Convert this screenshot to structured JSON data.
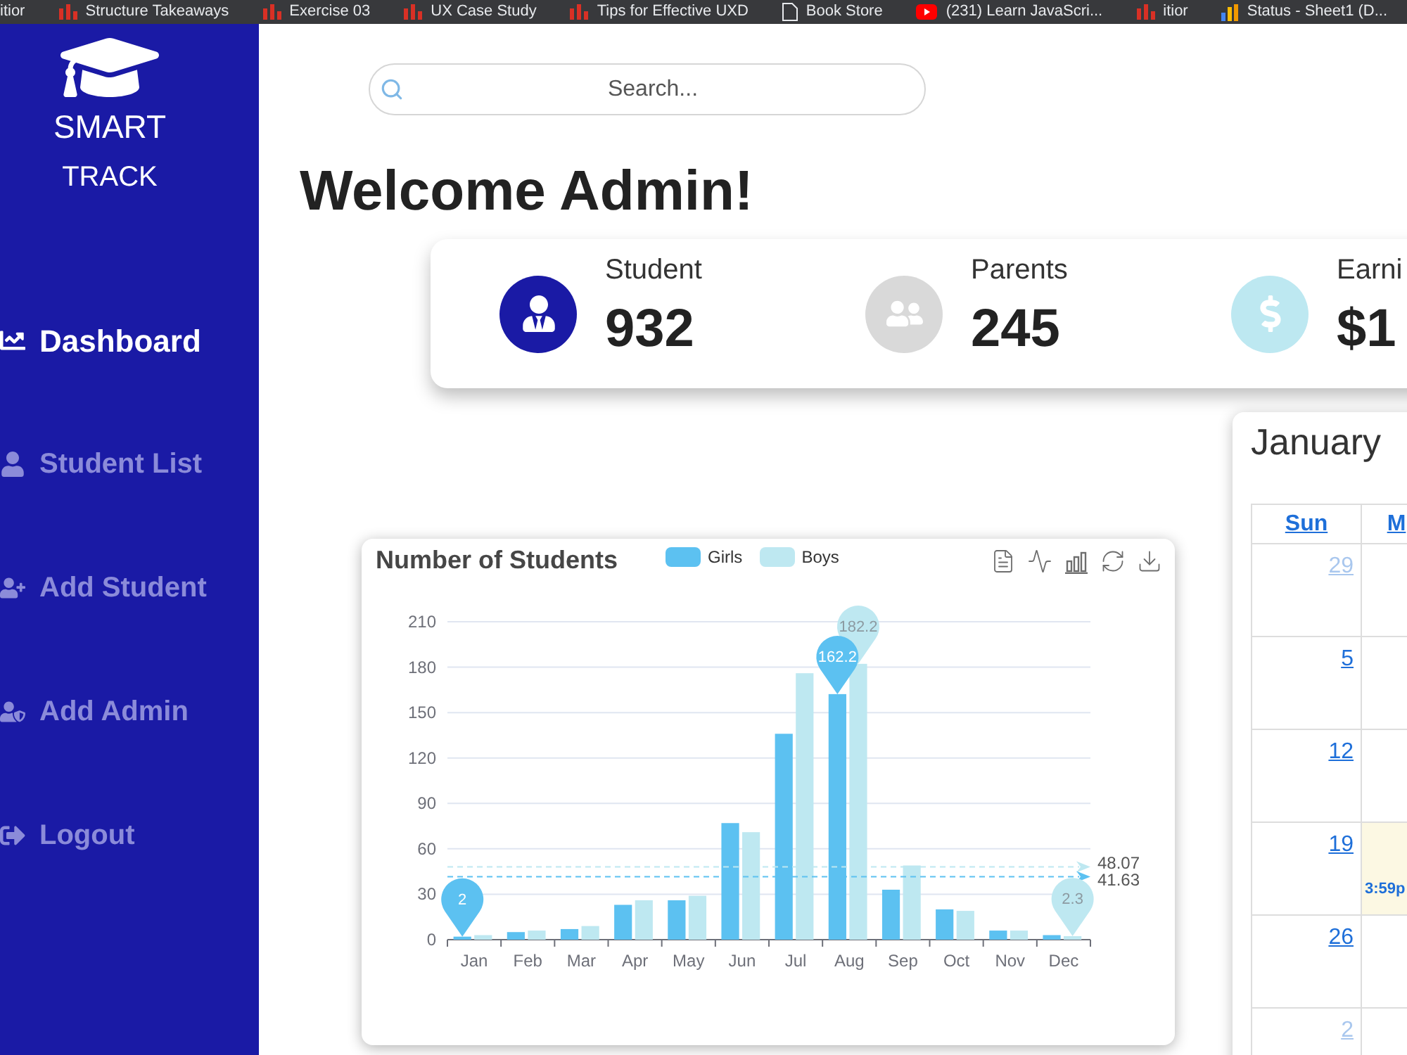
{
  "bookmarks": [
    {
      "label": "itior",
      "kind": "none"
    },
    {
      "label": "Structure Takeaways",
      "kind": "bars"
    },
    {
      "label": "Exercise 03",
      "kind": "bars"
    },
    {
      "label": "UX Case Study",
      "kind": "bars"
    },
    {
      "label": "Tips for Effective UXD",
      "kind": "bars"
    },
    {
      "label": "Book Store",
      "kind": "page"
    },
    {
      "label": "(231) Learn JavaScri...",
      "kind": "video"
    },
    {
      "label": "itior",
      "kind": "bars"
    },
    {
      "label": "Status - Sheet1 (D...",
      "kind": "chart"
    }
  ],
  "sidebar": {
    "logo": [
      "SMART",
      "TRACK"
    ],
    "items": [
      {
        "label": "Dashboard",
        "kind": "chart",
        "selected": true
      },
      {
        "label": "Student List",
        "kind": "user",
        "selected": false
      },
      {
        "label": "Add Student",
        "kind": "user-plus",
        "selected": false
      },
      {
        "label": "Add Admin",
        "kind": "user-shield",
        "selected": false
      },
      {
        "label": "Logout",
        "kind": "logout",
        "selected": false
      }
    ]
  },
  "search": {
    "placeholder": "Search..."
  },
  "heading": "Welcome Admin!",
  "stats": [
    {
      "label": "Student",
      "value": "932",
      "kind": "student",
      "color": "#1a1aa5"
    },
    {
      "label": "Parents",
      "value": "245",
      "kind": "parents",
      "color": "#d9d9d9"
    },
    {
      "label": "Earni",
      "value": "$1",
      "kind": "earnings",
      "color": "#bde8f1"
    }
  ],
  "students_chart": {
    "chart_data": {
      "type": "bar",
      "title": "Number of Students",
      "categories": [
        "Jan",
        "Feb",
        "Mar",
        "Apr",
        "May",
        "Jun",
        "Jul",
        "Aug",
        "Sep",
        "Oct",
        "Nov",
        "Dec"
      ],
      "series": [
        {
          "name": "Girls",
          "color": "#5cc1f1",
          "values": [
            2,
            5,
            7,
            23,
            26,
            77,
            136,
            162.2,
            33,
            20,
            6,
            3
          ]
        },
        {
          "name": "Boys",
          "color": "#bee8f1",
          "values": [
            3,
            6,
            9,
            26,
            29,
            71,
            176,
            182.2,
            49,
            19,
            6,
            2.3
          ]
        }
      ],
      "ylim": [
        0,
        210
      ],
      "yticks": [
        0,
        30,
        60,
        90,
        120,
        150,
        180,
        210
      ],
      "grid": true,
      "legend": "top",
      "ref_lines": [
        {
          "axis": "y",
          "value": 48.07,
          "label": "48.07",
          "color": "#bee8f1",
          "line_style": "dashed"
        },
        {
          "axis": "y",
          "value": 41.63,
          "label": "41.63",
          "color": "#5cc1f1",
          "line_style": "dashed"
        }
      ],
      "annotations": [
        "2",
        "162.2",
        "182.2",
        "2.3"
      ]
    }
  },
  "calendar": {
    "title": "January",
    "columns": [
      "Sun",
      "M"
    ],
    "weeks": [
      {
        "cells": [
          {
            "date": "29",
            "other_month": true,
            "today": false
          },
          {
            "today": false
          }
        ]
      },
      {
        "cells": [
          {
            "date": "5",
            "other_month": false,
            "today": false
          },
          {
            "today": false
          }
        ]
      },
      {
        "cells": [
          {
            "date": "12",
            "other_month": false,
            "today": false
          },
          {
            "today": false
          }
        ]
      },
      {
        "cells": [
          {
            "date": "19",
            "other_month": false,
            "today": false
          },
          {
            "today": true,
            "event": "3:59p"
          }
        ]
      },
      {
        "cells": [
          {
            "date": "26",
            "other_month": false,
            "today": false
          },
          {
            "today": false
          }
        ]
      },
      {
        "cells": [
          {
            "date": "2",
            "other_month": true,
            "today": false
          }
        ]
      }
    ]
  }
}
